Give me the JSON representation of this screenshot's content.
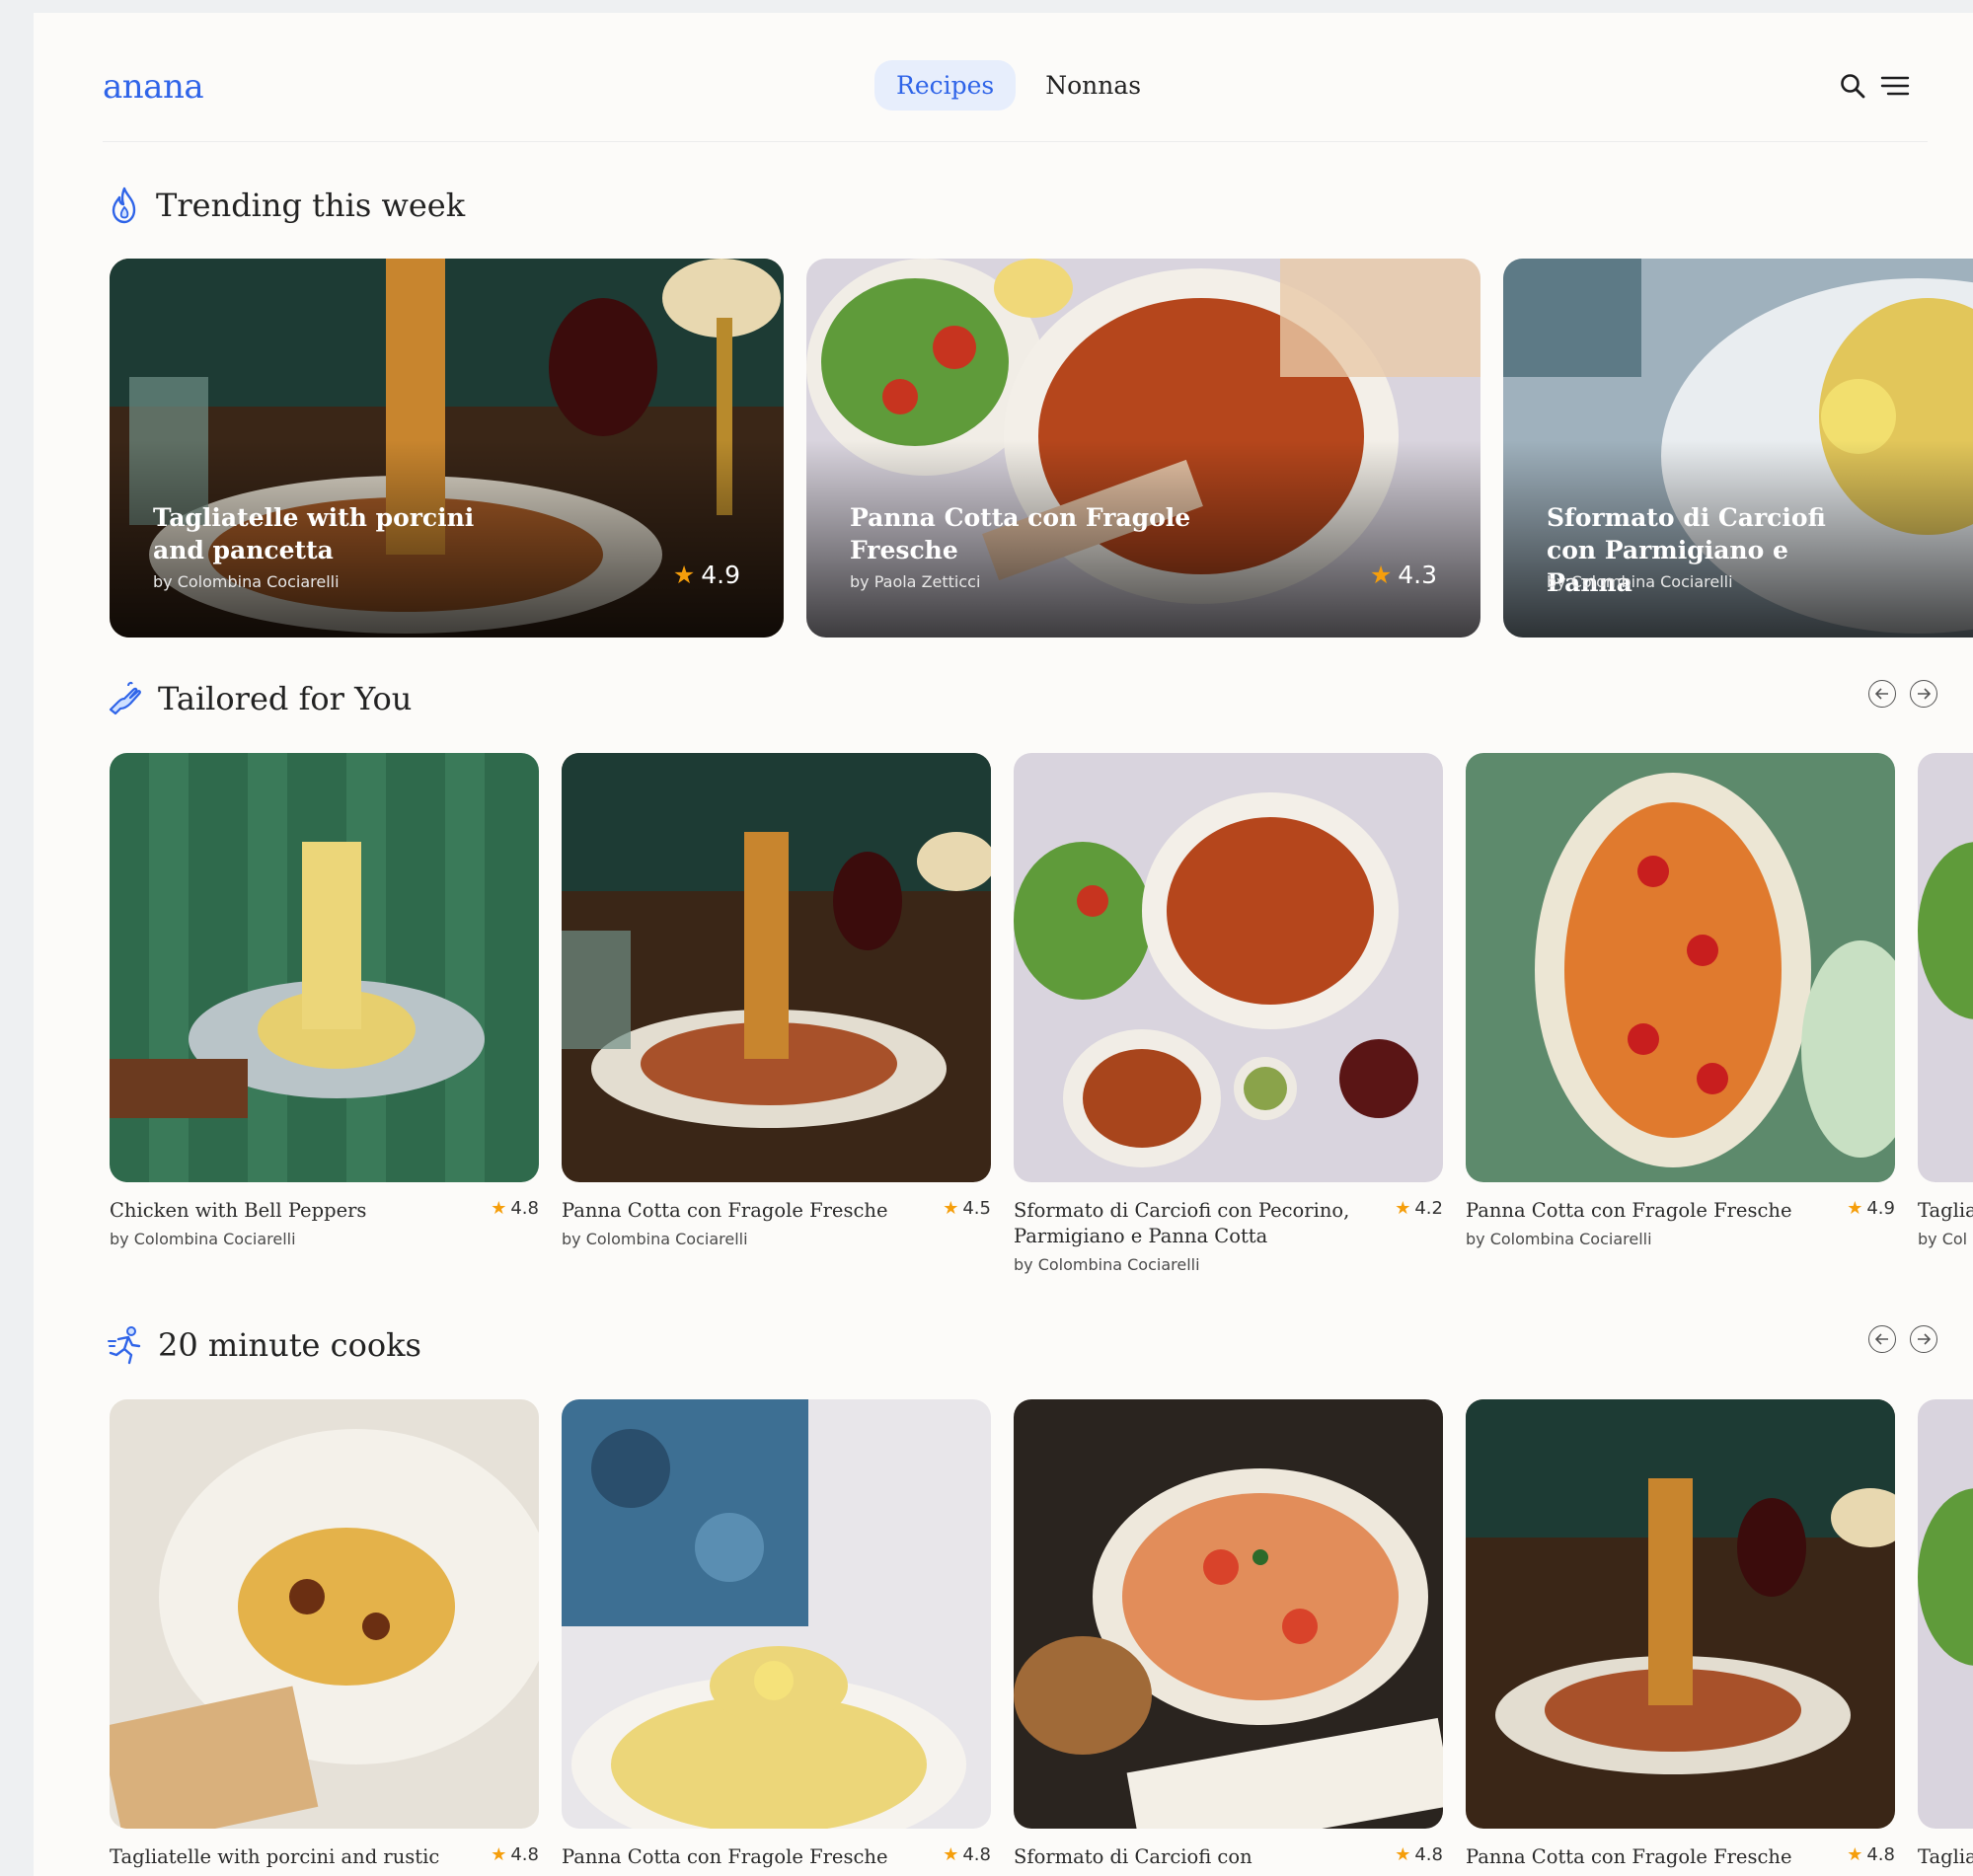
{
  "header": {
    "logo": "anana",
    "tabs": [
      {
        "label": "Recipes",
        "active": true
      },
      {
        "label": "Nonnas",
        "active": false
      }
    ],
    "icons": [
      "search-icon",
      "menu-icon"
    ]
  },
  "colors": {
    "accent": "#2f64e8",
    "active_tab_bg": "#e7eefc",
    "star": "#f59e0b",
    "page_bg": "#fcfbf9"
  },
  "trending": {
    "title": "Trending this week",
    "icon": "flame-icon",
    "cards": [
      {
        "title": "Tagliatelle with porcini and pancetta",
        "author": "by Colombina Cociarelli",
        "rating": "4.9"
      },
      {
        "title": "Panna Cotta con Fragole Fresche",
        "author": "by Paola Zetticci",
        "rating": "4.3"
      },
      {
        "title": "Sformato di Carciofi con Parmigiano e Panna",
        "author": "by Colombina Cociarelli",
        "rating": ""
      }
    ]
  },
  "tailored": {
    "title": "Tailored for You",
    "icon": "hand-icon",
    "cards": [
      {
        "title": "Chicken with Bell Peppers",
        "author": "by Colombina Cociarelli",
        "rating": "4.8"
      },
      {
        "title": "Panna Cotta con Fragole Fresche",
        "author": "by Colombina Cociarelli",
        "rating": "4.5"
      },
      {
        "title": "Sformato di Carciofi con Pecorino, Parmigiano e Panna Cotta",
        "author": "by Colombina Cociarelli",
        "rating": "4.2"
      },
      {
        "title": "Panna Cotta con Fragole Fresche",
        "author": "by Colombina Cociarelli",
        "rating": "4.9"
      },
      {
        "title": "Taglia panc",
        "author": "by Col",
        "rating": ""
      }
    ]
  },
  "quick": {
    "title": "20 minute cooks",
    "icon": "running-icon",
    "cards": [
      {
        "title": "Tagliatelle with porcini and rustic",
        "author": "",
        "rating": "4.8"
      },
      {
        "title": "Panna Cotta con Fragole Fresche",
        "author": "",
        "rating": "4.8"
      },
      {
        "title": "Sformato di Carciofi con",
        "author": "",
        "rating": "4.8"
      },
      {
        "title": "Panna Cotta con Fragole Fresche",
        "author": "",
        "rating": "4.8"
      },
      {
        "title": "Taglia",
        "author": "",
        "rating": ""
      }
    ]
  }
}
